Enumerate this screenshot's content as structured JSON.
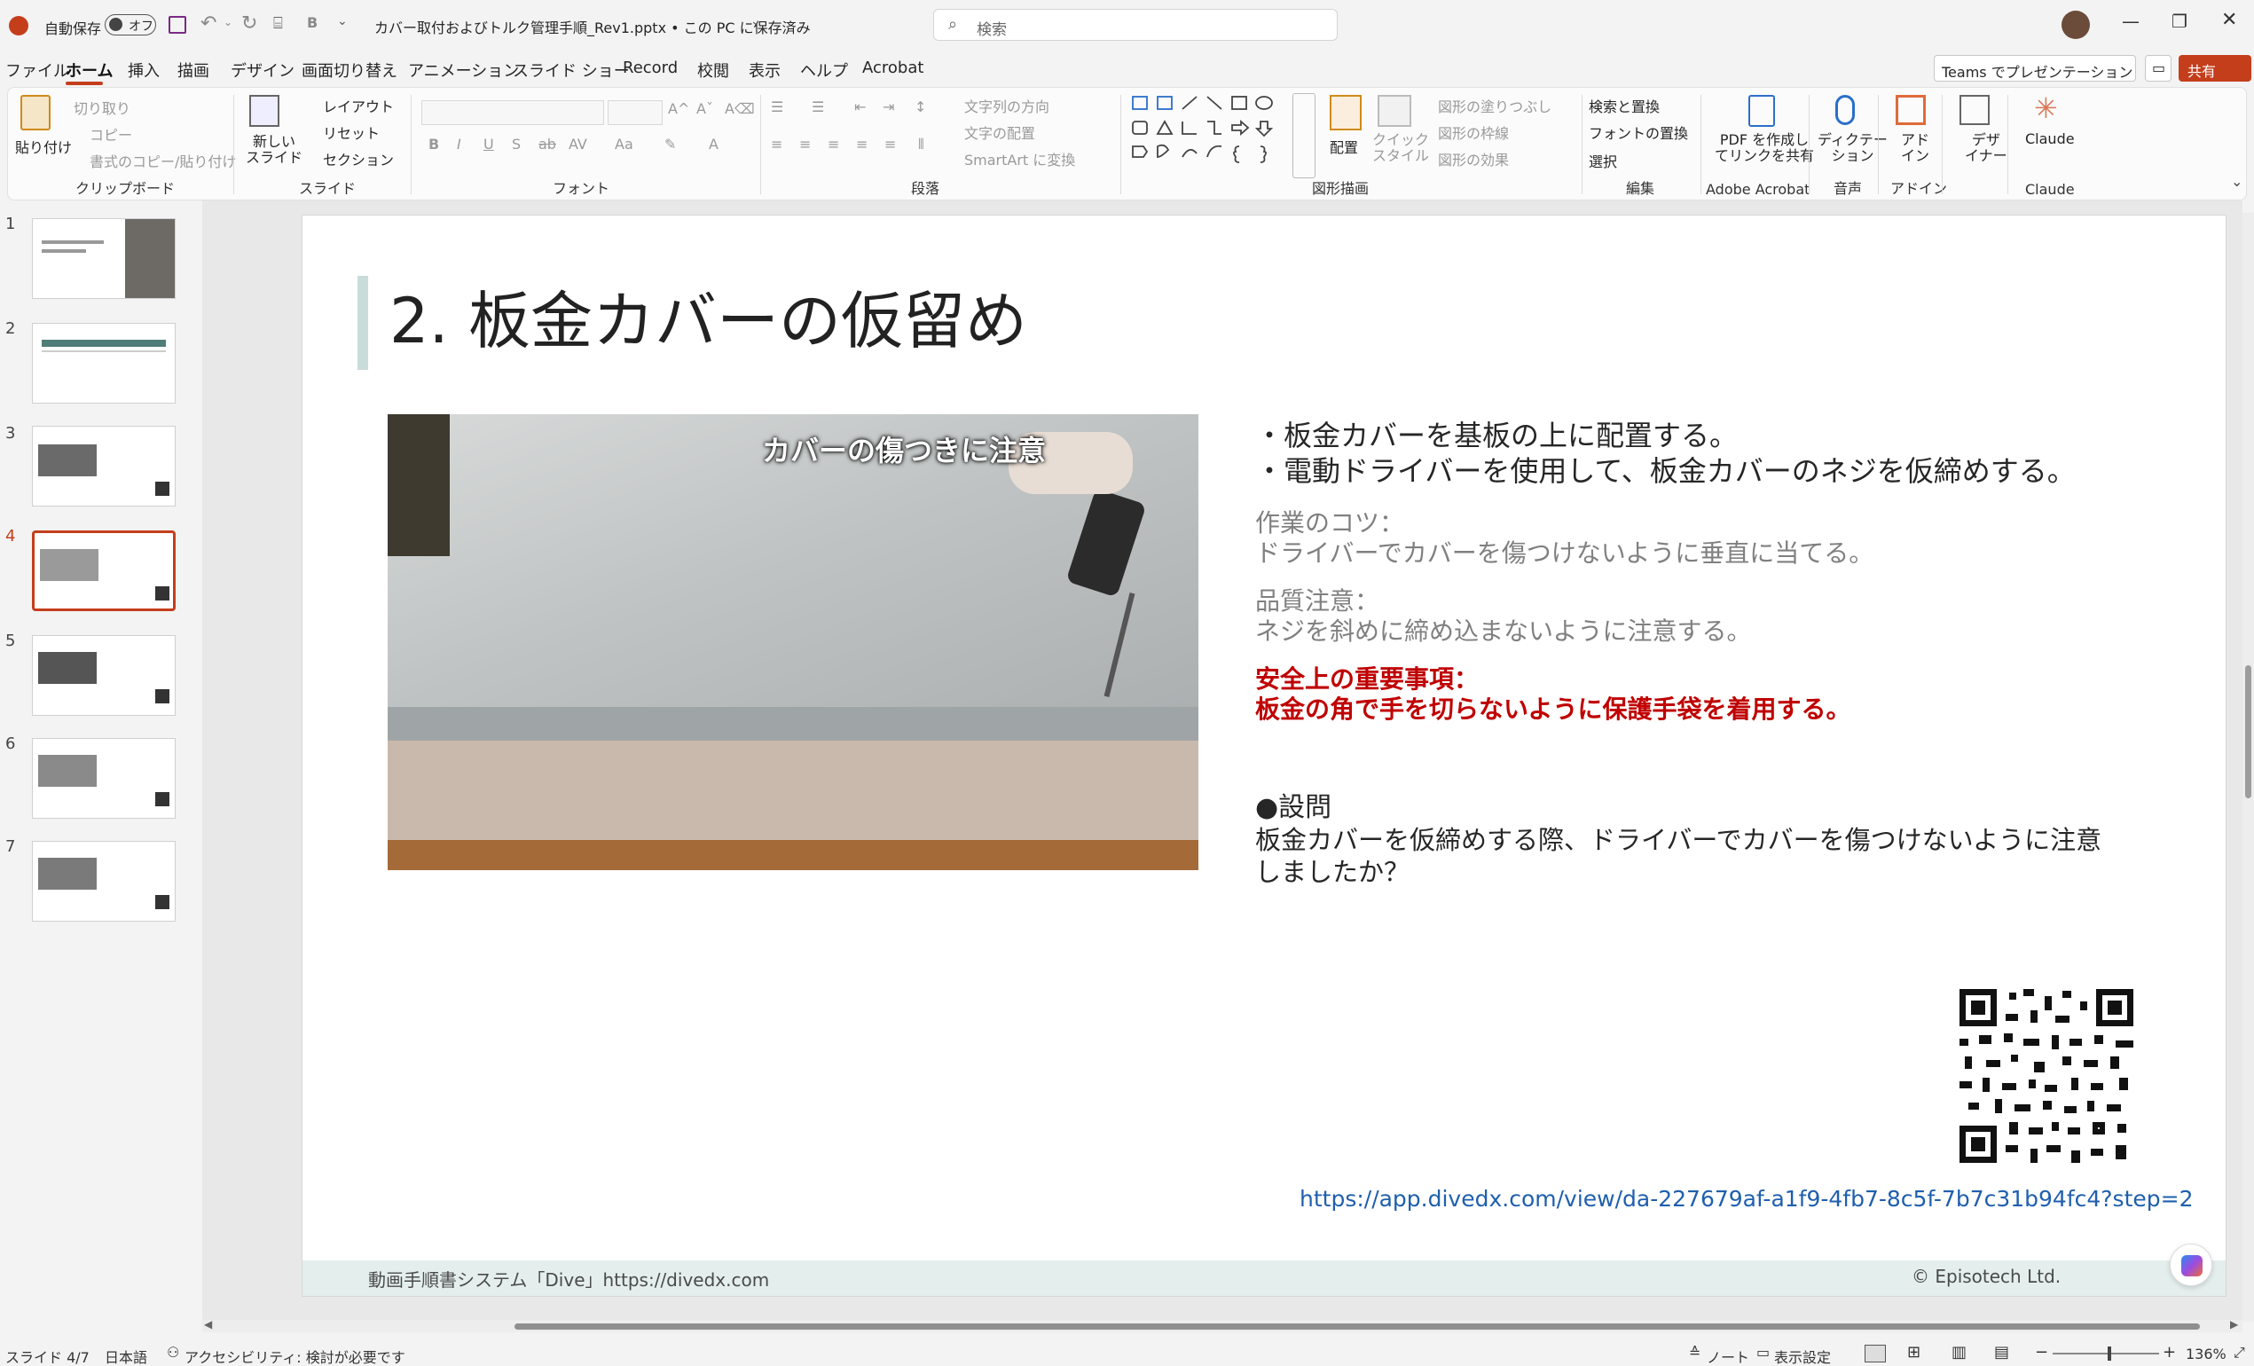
{
  "titlebar": {
    "autosave_label": "自動保存",
    "autosave_state": "オフ",
    "file_title": "カバー取付およびトルク管理手順_Rev1.pptx • この PC に保存済み",
    "search_placeholder": "検索"
  },
  "menu": {
    "tabs": [
      "ファイル",
      "ホーム",
      "挿入",
      "描画",
      "デザイン",
      "画面切り替え",
      "アニメーション",
      "スライド ショー",
      "Record",
      "校閲",
      "表示",
      "ヘルプ",
      "Acrobat"
    ],
    "active_tab": "ホーム",
    "teams_button": "Teams でプレゼンテーション",
    "share_button": "共有"
  },
  "ribbon": {
    "clipboard": {
      "paste": "貼り付け",
      "cut": "切り取り",
      "copy": "コピー",
      "format_painter": "書式のコピー/貼り付け",
      "label": "クリップボード"
    },
    "slides": {
      "new_slide": "新しい\nスライド",
      "layout": "レイアウト",
      "reset": "リセット",
      "section": "セクション",
      "label": "スライド"
    },
    "font": {
      "label": "フォント"
    },
    "paragraph": {
      "text_direction": "文字列の方向",
      "align_text": "文字の配置",
      "smartart": "SmartArt に変換",
      "label": "段落"
    },
    "drawing": {
      "arrange": "配置",
      "quick_styles": "クイック\nスタイル",
      "shape_fill": "図形の塗りつぶし",
      "shape_outline": "図形の枠線",
      "shape_effects": "図形の効果",
      "label": "図形描画"
    },
    "editing": {
      "find_replace": "検索と置換",
      "replace_fonts": "フォントの置換",
      "select": "選択",
      "label": "編集"
    },
    "acrobat": {
      "create_pdf": "PDF を作成し\nてリンクを共有",
      "label": "Adobe Acrobat"
    },
    "voice": {
      "dictate": "ディクテー\nション",
      "label": "音声"
    },
    "addins": {
      "addins": "アド\nイン",
      "label": "アドイン"
    },
    "designer": {
      "designer": "デザ\nイナー"
    },
    "claude": {
      "button": "Claude",
      "label": "Claude"
    }
  },
  "thumbnails": {
    "numbers": [
      "1",
      "2",
      "3",
      "4",
      "5",
      "6",
      "7"
    ],
    "active": 4
  },
  "slide": {
    "title": "2. 板金カバーの仮留め",
    "image_caption": "カバーの傷つきに注意",
    "bullet1": "・板金カバーを基板の上に配置する。",
    "bullet2": "・電動ドライバーを使用して、板金カバーのネジを仮締めする。",
    "tip_heading": "作業のコツ：",
    "tip_text": "ドライバーでカバーを傷つけないように垂直に当てる。",
    "quality_heading": "品質注意：",
    "quality_text": "ネジを斜めに締め込まないように注意する。",
    "safety_heading": "安全上の重要事項：",
    "safety_text": "板金の角で手を切らないように保護手袋を着用する。",
    "question_heading": "●設問",
    "question_line1": "板金カバーを仮締めする際、ドライバーでカバーを傷つけないように注意",
    "question_line2": "しましたか？",
    "url": "https://app.divedx.com/view/da-227679af-a1f9-4fb7-8c5f-7b7c31b94fc4?step=2",
    "footer_left": "動画手順書システム「Dive」https://divedx.com",
    "footer_right": "© Episotech Ltd.",
    "colors": {
      "accent_bar": "#c9dcd9",
      "footer_bg": "#e4eeed",
      "red": "#c00000",
      "link": "#1f5fae"
    }
  },
  "status": {
    "slide_counter": "スライド 4/7",
    "language": "日本語",
    "accessibility": "アクセシビリティ: 検討が必要です",
    "notes": "ノート",
    "display_settings": "表示設定",
    "zoom": "136%"
  }
}
